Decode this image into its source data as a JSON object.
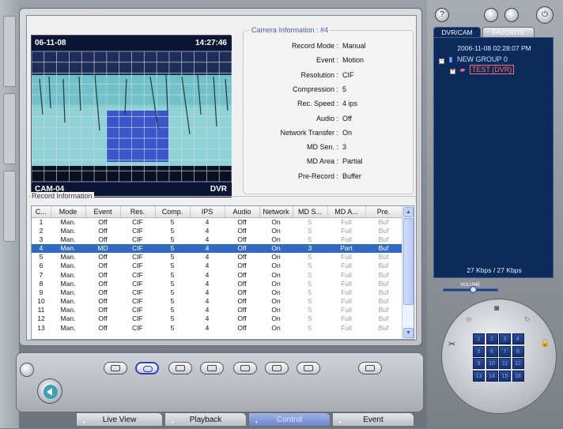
{
  "video": {
    "date": "06-11-08",
    "time": "14:27:46",
    "camera_name": "CAM-04",
    "source": "DVR"
  },
  "camera_info": {
    "title": "Camera Information : #4",
    "rows": [
      {
        "label": "Record Mode :",
        "value": "Manual"
      },
      {
        "label": "Event :",
        "value": "Motion"
      },
      {
        "label": "Resolution :",
        "value": "CIF"
      },
      {
        "label": "Compression :",
        "value": "5"
      },
      {
        "label": "Rec. Speed :",
        "value": "4 ips"
      },
      {
        "label": "Audio :",
        "value": "Off"
      },
      {
        "label": "Network Transfer :",
        "value": "On"
      },
      {
        "label": "MD Sen. :",
        "value": "3"
      },
      {
        "label": "MD Area :",
        "value": "Partial"
      },
      {
        "label": "Pre-Record :",
        "value": "Buffer"
      }
    ]
  },
  "record": {
    "title": "Record Information",
    "columns": [
      "C...",
      "Mode",
      "Event",
      "Res.",
      "Comp.",
      "IPS",
      "Audio",
      "Network",
      "MD S...",
      "MD A...",
      "Pre."
    ],
    "selected_row": 3,
    "rows": [
      [
        "1",
        "Man.",
        "Off",
        "CIF",
        "5",
        "4",
        "Off",
        "On",
        "5",
        "Full",
        "Buf"
      ],
      [
        "2",
        "Man.",
        "Off",
        "CIF",
        "5",
        "4",
        "Off",
        "On",
        "5",
        "Full",
        "Buf"
      ],
      [
        "3",
        "Man.",
        "Off",
        "CIF",
        "5",
        "4",
        "Off",
        "On",
        "5",
        "Full",
        "Buf"
      ],
      [
        "4",
        "Man.",
        "MD",
        "CIF",
        "5",
        "4",
        "Off",
        "On",
        "3",
        "Part",
        "Buf"
      ],
      [
        "5",
        "Man.",
        "Off",
        "CIF",
        "5",
        "4",
        "Off",
        "On",
        "5",
        "Full",
        "Buf"
      ],
      [
        "6",
        "Man.",
        "Off",
        "CIF",
        "5",
        "4",
        "Off",
        "On",
        "5",
        "Full",
        "Buf"
      ],
      [
        "7",
        "Man.",
        "Off",
        "CIF",
        "5",
        "4",
        "Off",
        "On",
        "5",
        "Full",
        "Buf"
      ],
      [
        "8",
        "Man.",
        "Off",
        "CIF",
        "5",
        "4",
        "Off",
        "On",
        "5",
        "Full",
        "Buf"
      ],
      [
        "9",
        "Man.",
        "Off",
        "CIF",
        "5",
        "4",
        "Off",
        "On",
        "5",
        "Full",
        "Buf"
      ],
      [
        "10",
        "Man.",
        "Off",
        "CIF",
        "5",
        "4",
        "Off",
        "On",
        "5",
        "Full",
        "Buf"
      ],
      [
        "11",
        "Man.",
        "Off",
        "CIF",
        "5",
        "4",
        "Off",
        "On",
        "5",
        "Full",
        "Buf"
      ],
      [
        "12",
        "Man.",
        "Off",
        "CIF",
        "5",
        "4",
        "Off",
        "On",
        "5",
        "Full",
        "Buf"
      ],
      [
        "13",
        "Man.",
        "Off",
        "CIF",
        "5",
        "4",
        "Off",
        "On",
        "5",
        "Full",
        "Buf"
      ]
    ]
  },
  "tabs": [
    {
      "label": "Live View",
      "active": false
    },
    {
      "label": "Playback",
      "active": false
    },
    {
      "label": "Control",
      "active": true
    },
    {
      "label": "Event",
      "active": false
    }
  ],
  "right_panel": {
    "tab_dvr": "DVR/CAM",
    "tab_favorite": "FAVORITE",
    "datetime": "2006-11-08 02:28:07 PM",
    "group": "NEW GROUP 0",
    "device": "TEST (DVR)",
    "kbps": "27 Kbps / 27 Kbps",
    "volume_label": "VOLUME",
    "volume_level": 0.55,
    "help_glyph": "?",
    "keys": [
      "1",
      "2",
      "3",
      "4",
      "5",
      "6",
      "7",
      "8",
      "9",
      "10",
      "11",
      "12",
      "13",
      "14",
      "15",
      "16"
    ]
  },
  "colors": {
    "selection": "#316ac5",
    "panel_navy": "#0c2a5a",
    "device_red": "#ff6a6a"
  }
}
